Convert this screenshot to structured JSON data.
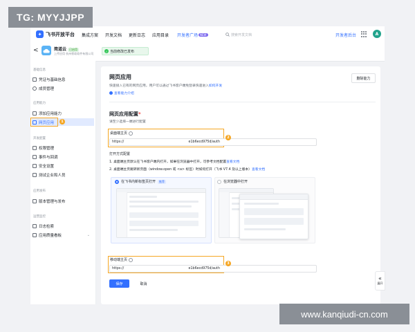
{
  "watermarks": {
    "top": "TG: MYYJJPP",
    "bottom": "www.kanqiudi-cn.com"
  },
  "topbar": {
    "brand": "飞书开放平台",
    "nav": [
      "集成方案",
      "开发文档",
      "更新日志",
      "应用目录"
    ],
    "nav_active": "开发者广场",
    "nav_new_badge": "NEW",
    "search_placeholder": "搜索开发文档",
    "developer_console": "开发者后台",
    "avatar_letter": "A"
  },
  "app": {
    "back": "<",
    "name": "简道云",
    "tag": "已启用",
    "company": "上传应用 杭州帆软软件有限公司",
    "toast": "当前修改已发布"
  },
  "sidebar": {
    "sections": [
      {
        "title": "基础信息",
        "items": [
          {
            "label": "凭证与基础信息"
          },
          {
            "label": "成员管理"
          }
        ]
      },
      {
        "title": "应用能力",
        "items": [
          {
            "label": "添加应用能力"
          },
          {
            "label": "网页应用",
            "active": true
          }
        ]
      },
      {
        "title": "开发配置",
        "items": [
          {
            "label": "权限管理"
          },
          {
            "label": "事件与回调"
          },
          {
            "label": "安全设置"
          },
          {
            "label": "测试企业和人员"
          }
        ]
      },
      {
        "title": "应用发布",
        "items": [
          {
            "label": "版本管理与发布"
          }
        ]
      },
      {
        "title": "运营监控",
        "items": [
          {
            "label": "日志检索"
          },
          {
            "label": "应用质量看板",
            "caret": "⌄"
          }
        ]
      }
    ]
  },
  "main": {
    "title": "网页应用",
    "desc_pre": "快速接入已有的网页应用，用户可以通过飞书客户端免登录快速进入",
    "desc_link": "如何开发",
    "intro_link": "查看能力介绍",
    "delete_btn": "删除能力",
    "config_title": "网页应用配置",
    "config_req": "*",
    "config_sub": "请至少选择一端进行配置",
    "desktop_label": "桌面端主页",
    "desktop_url_left": "https://",
    "desktop_url_right": "e1b6ecd975d/auth",
    "open_title": "打开方式配置",
    "open_line1_pre": "1. 桌面端主页默认在飞书客户端内打开，如果在浏览器中打开，可参考文档配置",
    "open_line1_link": "查看文档",
    "open_line2_pre": "2. 桌面端主页跳转新页面（window.open 或 <a> 标签）时如何打开（飞书 V7.4 及以上版本）",
    "open_line2_link": "查看文档",
    "option_in_app": "在飞书内新标签页打开",
    "option_in_app_tag": "推荐",
    "option_browser": "在浏览器中打开",
    "mobile_label": "移动端主页",
    "mobile_url_left": "https://",
    "mobile_url_right": "e1b6ecd975d/auth",
    "save_btn": "保存",
    "cancel_btn": "取消",
    "expand": "展开",
    "expand_icon": "«",
    "markers": [
      "1",
      "2",
      "3"
    ]
  },
  "colors": {
    "primary": "#3370ff",
    "highlight": "#f5a623",
    "success": "#34c759"
  }
}
